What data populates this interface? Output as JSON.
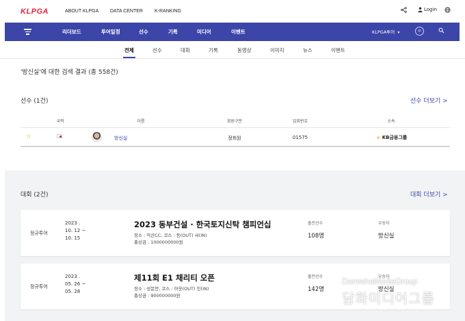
{
  "header": {
    "logo": "KLPGA",
    "links": [
      "ABOUT KLPGA",
      "DATA CENTER",
      "K-RANKING"
    ],
    "login": "Login"
  },
  "nav": {
    "items": [
      "리더보드",
      "투어일정",
      "선수",
      "기록",
      "미디어",
      "이벤트"
    ],
    "tour_select": "KLPGA투어",
    "tour_select_arrow": "▾"
  },
  "tabs": [
    "전체",
    "선수",
    "대회",
    "기록",
    "동영상",
    "이미지",
    "뉴스",
    "이벤트"
  ],
  "search": {
    "summary": "'방신실'에 대한 검색 결과 (총 558건)"
  },
  "players": {
    "title": "선수 (1건)",
    "more": "선수 더보기 >",
    "columns": [
      "국적",
      "이름",
      "회원구분",
      "입회번호",
      "소속"
    ],
    "row": {
      "name": "방신실",
      "member_type": "정회원",
      "member_no": "01575",
      "affiliation": "KB금융그룹"
    }
  },
  "tournaments": {
    "title": "대회 (2건)",
    "more": "대회 더보기 >",
    "entries_label": "출전선수",
    "winner_label": "우승자",
    "items": [
      {
        "tour": "정규투어",
        "date_line1": "2023 .",
        "date_line2": "10. 12 ~",
        "date_line3": "10. 15",
        "name": "2023 동부건설 · 한국토지신탁 챔피언십",
        "venue": "장소 : 익산CC, 코스 : 동(OUT) 서(IN)",
        "prize": "총상금 : 1000000000원",
        "entries": "108명",
        "winner": "방신실"
      },
      {
        "tour": "정규투어",
        "date_line1": "2023 .",
        "date_line2": "05. 26 ~",
        "date_line3": "05. 28",
        "name": "제11회 E1 채리티 오픈",
        "venue": "장소 : 성문안, 코스 : 아웃(OUT) 인(IN)",
        "prize": "총상금 : 900000000원",
        "entries": "142명",
        "winner": "방신실"
      }
    ]
  },
  "watermark": {
    "line1": "DamwhaMediaGroup",
    "line2": "담화미디어그룹"
  },
  "colors": {
    "brand": "#3c45a8",
    "logo": "#e2233a"
  }
}
